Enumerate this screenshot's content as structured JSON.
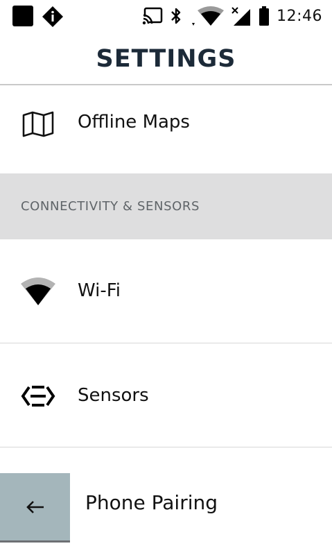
{
  "status_bar": {
    "time": "12:46",
    "icons": [
      "notification-square-icon",
      "alert-diamond-icon",
      "cast-icon",
      "bluetooth-icon",
      "wifi-signal-icon",
      "cell-signal-icon",
      "battery-icon"
    ]
  },
  "header": {
    "title": "SETTINGS"
  },
  "items": [
    {
      "label": "Offline Maps",
      "icon": "map-icon"
    },
    {
      "label": "Wi-Fi",
      "icon": "wifi-icon"
    },
    {
      "label": "Sensors",
      "icon": "sensors-icon"
    },
    {
      "label": "Phone Pairing",
      "icon": "back-arrow-icon"
    }
  ],
  "section": {
    "title": "CONNECTIVITY & SENSORS"
  },
  "colors": {
    "header_text": "#1c2a38",
    "section_bg": "#dededf",
    "back_button_bg": "#a4b6bb"
  }
}
